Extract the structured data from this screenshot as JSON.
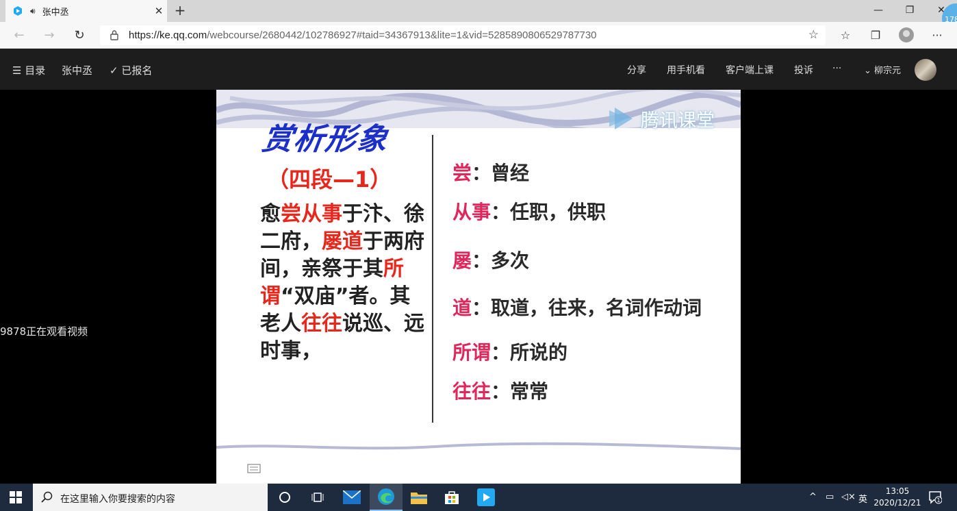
{
  "browser": {
    "tab_title": "张中丞",
    "url_host": "https://ke.qq.com",
    "url_path": "/webcourse/2680442/102786927#taid=34367913&lite=1&vid=5285890806529787730",
    "corner_badge": "178"
  },
  "site_header": {
    "menu_label": "目录",
    "course_title": "张中丞",
    "enrolled_label": "已报名",
    "share": "分享",
    "mobile": "用手机看",
    "client": "客户端上课",
    "complaint": "投诉",
    "more": "···",
    "teacher": "柳宗元"
  },
  "stage": {
    "viewers_text": "9878正在观看视频"
  },
  "slide": {
    "logo_text": "腾讯课堂",
    "title": "赏析形象",
    "subtitle": "（四段—1）",
    "passage": [
      {
        "t": "愈",
        "h": false
      },
      {
        "t": "尝从事",
        "h": true
      },
      {
        "t": "于汴、徐二府，",
        "h": false
      },
      {
        "t": "屡道",
        "h": true
      },
      {
        "t": "于两府间，亲祭于其",
        "h": false
      },
      {
        "t": "所谓",
        "h": true
      },
      {
        "t": "“双庙”者。其老人",
        "h": false
      },
      {
        "t": "往往",
        "h": true
      },
      {
        "t": "说巡、远时事，",
        "h": false
      }
    ],
    "glosses": [
      {
        "term": "尝",
        "meaning": "：曾经"
      },
      {
        "term": "从事",
        "meaning": "：任职，供职"
      },
      {
        "term": "屡",
        "meaning": "：多次"
      },
      {
        "term": "道",
        "meaning": "：取道，往来，名词作动词"
      },
      {
        "term": "所谓",
        "meaning": "：所说的"
      },
      {
        "term": "往往",
        "meaning": "：常常"
      }
    ]
  },
  "taskbar": {
    "search_placeholder": "在这里输入你要搜索的内容",
    "ime": "英",
    "time": "13:05",
    "date": "2020/12/21",
    "notification_count": "1"
  }
}
